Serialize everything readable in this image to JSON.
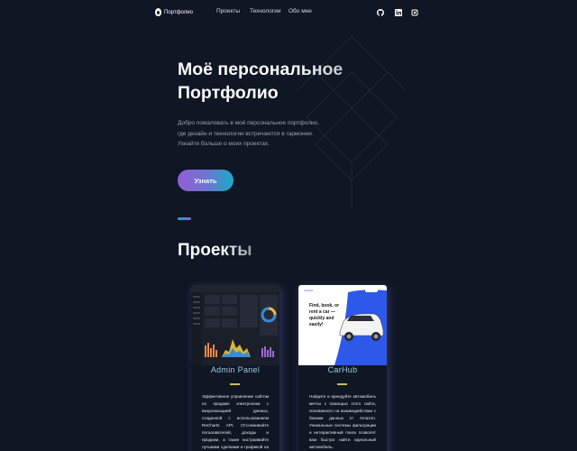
{
  "header": {
    "logo_text": "Портфолио",
    "nav": [
      "Проекты",
      "Технологии",
      "Обо мне"
    ],
    "socials": [
      "github-icon",
      "linkedin-icon",
      "instagram-icon"
    ]
  },
  "hero": {
    "title_line1": "Моё персональное",
    "title_line2": "Портфолио",
    "description": "Добро пожаловать в моё персональное портфолио, где дизайн и технологии встречаются в гармонии. Узнайте больше о моих проектах.",
    "cta_label": "Узнать"
  },
  "projects": {
    "title": "Проекты",
    "cards": [
      {
        "title": "Admin Panel",
        "description": "Эффективное управление сайтом по продаже электроники с визуализацией данных, созданной с использованием ReCharts API. Отслеживайте пользователей, доходы и продажи, а также настраивайте лучшими сделками и графикой на этой"
      },
      {
        "title": "CarHub",
        "description": "Найдите и арендуйте автомобиль мечты с помощью этого сайта, основанного на взаимодействии с базами данных от Amazon. Уникальные системы фильтрации и интерактивный поиск позволят вам быстро найти идеальный автомобиль."
      }
    ],
    "carhub_thumb": {
      "headline": [
        "Find, book, or",
        "rent a car —",
        "quickly and",
        "easily!"
      ],
      "brand": "CarHub"
    }
  },
  "colors": {
    "background": "#0f1624",
    "accent_start": "#945dd6",
    "accent_end": "#13adc7",
    "card_title": "#9cc9e3",
    "card_line": "#d0bb57"
  }
}
